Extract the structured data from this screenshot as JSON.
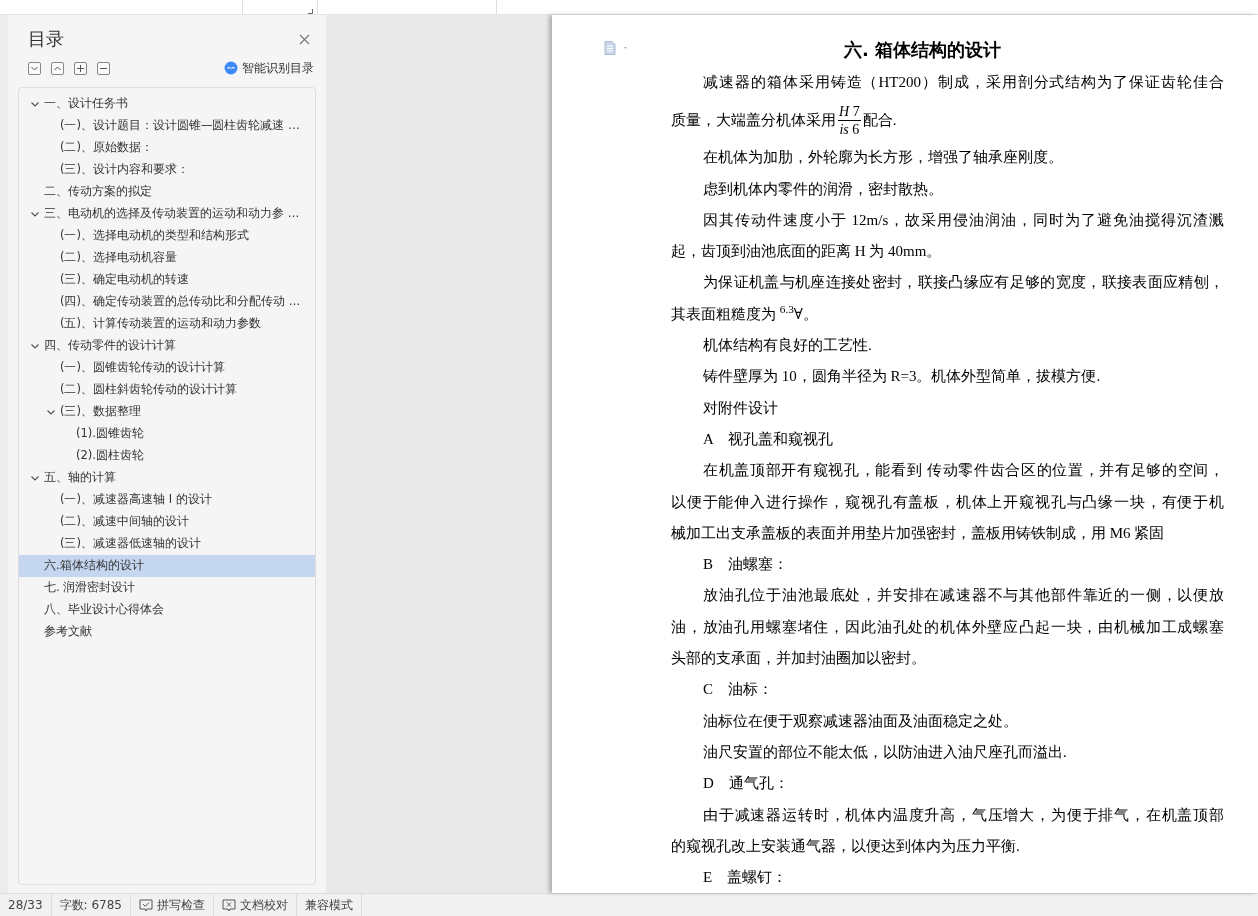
{
  "outline_panel": {
    "title": "目录",
    "smart_toc_label": "智能识别目录",
    "items": [
      {
        "text": "一、设计任务书",
        "expanded": true,
        "selected": false,
        "children": [
          {
            "text": "(一)、设计题目：设计圆锥—圆柱齿轮减速 …",
            "selected": false
          },
          {
            "text": "(二)、原始数据：",
            "selected": false
          },
          {
            "text": "(三)、设计内容和要求：",
            "selected": false
          }
        ]
      },
      {
        "text": "二、传动方案的拟定",
        "selected": false
      },
      {
        "text": "三、电动机的选择及传动装置的运动和动力参 …",
        "expanded": true,
        "selected": false,
        "children": [
          {
            "text": "(一)、选择电动机的类型和结构形式",
            "selected": false
          },
          {
            "text": "(二)、选择电动机容量",
            "selected": false
          },
          {
            "text": "(三)、确定电动机的转速",
            "selected": false
          },
          {
            "text": "(四)、确定传动装置的总传动比和分配传动 …",
            "selected": false
          },
          {
            "text": "(五)、计算传动装置的运动和动力参数",
            "selected": false
          }
        ]
      },
      {
        "text": "四、传动零件的设计计算",
        "expanded": true,
        "selected": false,
        "children": [
          {
            "text": "(一)、圆锥齿轮传动的设计计算",
            "selected": false
          },
          {
            "text": "(二)、圆柱斜齿轮传动的设计计算",
            "selected": false
          },
          {
            "text": "(三)、数据整理",
            "expanded": true,
            "selected": false,
            "children": [
              {
                "text": "(1).圆锥齿轮",
                "selected": false
              },
              {
                "text": "(2).圆柱齿轮",
                "selected": false
              }
            ]
          }
        ]
      },
      {
        "text": "五、轴的计算",
        "expanded": true,
        "selected": false,
        "children": [
          {
            "text": "(一)、减速器高速轴 I 的设计",
            "selected": false
          },
          {
            "text": "(二)、减速中间轴的设计",
            "selected": false
          },
          {
            "text": "(三)、减速器低速轴的设计",
            "selected": false
          }
        ]
      },
      {
        "text": "六.箱体结构的设计",
        "selected": true
      },
      {
        "text": "七. 润滑密封设计",
        "selected": false
      },
      {
        "text": "八、毕业设计心得体会",
        "selected": false
      },
      {
        "text": "参考文献",
        "selected": false
      }
    ]
  },
  "document": {
    "title": "六. 箱体结构的设计",
    "paragraphs": [
      {
        "lines": [
          "减速器的箱体采用铸造（HT200）制成，采用剖分式结构为了保证齿轮佳合",
          {
            "before": "质量，大端盖分机体采用",
            "numerator": "*H* 7",
            "denominator": "*is* 6",
            "after": "配合."
          }
        ]
      },
      {
        "lines": [
          "在机体为加肋，外轮廓为长方形，增强了轴承座刚度。"
        ]
      },
      {
        "lines": [
          "虑到机体内零件的润滑，密封散热。"
        ]
      },
      {
        "lines": [
          "因其传动件速度小于 12m/s，故采用侵油润油，同时为了避免油搅得沉渣溅",
          "起，齿顶到油池底面的距离 H 为 40mm。"
        ]
      },
      {
        "lines": [
          "为保证机盖与机座连接处密封，联接凸缘应有足够的宽度，联接表面应精刨，",
          "其表面粗糙度为 $^{6.3}$∀。"
        ]
      },
      {
        "lines": [
          "机体结构有良好的工艺性."
        ]
      },
      {
        "lines": [
          "铸件壁厚为 10，圆角半径为 R=3。机体外型简单，拔模方便."
        ]
      },
      {
        "lines": [
          "对附件设计"
        ]
      },
      {
        "lines": [
          "A　视孔盖和窥视孔"
        ]
      },
      {
        "lines": [
          "在机盖顶部开有窥视孔，能看到 传动零件齿合区的位置，并有足够的空间，",
          "以便于能伸入进行操作，窥视孔有盖板，机体上开窥视孔与凸缘一块，有便于机",
          "械加工出支承盖板的表面并用垫片加强密封，盖板用铸铁制成，用 M6 紧固"
        ]
      },
      {
        "lines": [
          "B　油螺塞："
        ]
      },
      {
        "lines": [
          "放油孔位于油池最底处，并安排在减速器不与其他部件靠近的一侧，以便放",
          "油，放油孔用螺塞堵住，因此油孔处的机体外壁应凸起一块，由机械加工成螺塞",
          "头部的支承面，并加封油圈加以密封。"
        ]
      },
      {
        "lines": [
          "C　油标："
        ]
      },
      {
        "lines": [
          "油标位在便于观察减速器油面及油面稳定之处。"
        ]
      },
      {
        "lines": [
          "油尺安置的部位不能太低，以防油进入油尺座孔而溢出."
        ]
      },
      {
        "lines": [
          "D　通气孔："
        ]
      },
      {
        "lines": [
          "由于减速器运转时，机体内温度升高，气压增大，为便于排气，在机盖顶部",
          "的窥视孔改上安装通气器，以便达到体内为压力平衡."
        ]
      },
      {
        "lines": [
          "E　盖螺钉："
        ]
      }
    ]
  },
  "status_bar": {
    "page": "28/33",
    "word_count": "字数: 6785",
    "spell_check": "拼写检查",
    "proofread": "文档校对",
    "compat_mode": "兼容模式"
  }
}
